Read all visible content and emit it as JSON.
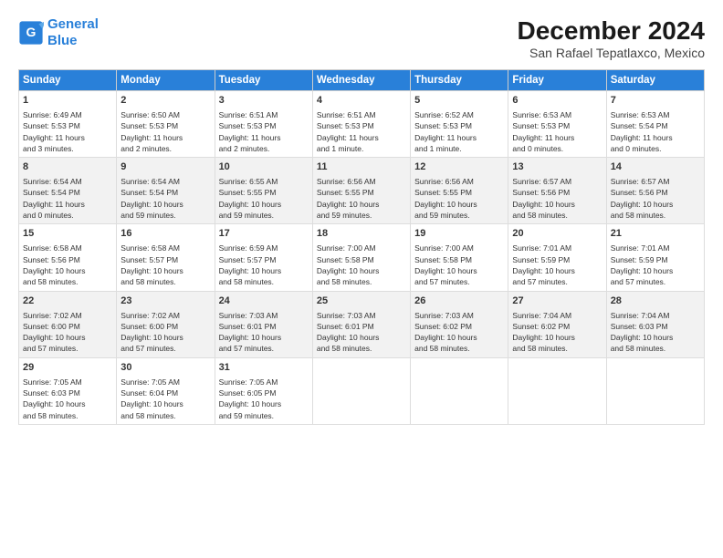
{
  "header": {
    "logo_line1": "General",
    "logo_line2": "Blue",
    "main_title": "December 2024",
    "subtitle": "San Rafael Tepatlaxco, Mexico"
  },
  "columns": [
    "Sunday",
    "Monday",
    "Tuesday",
    "Wednesday",
    "Thursday",
    "Friday",
    "Saturday"
  ],
  "weeks": [
    [
      {
        "day": "1",
        "info": "Sunrise: 6:49 AM\nSunset: 5:53 PM\nDaylight: 11 hours\nand 3 minutes."
      },
      {
        "day": "2",
        "info": "Sunrise: 6:50 AM\nSunset: 5:53 PM\nDaylight: 11 hours\nand 2 minutes."
      },
      {
        "day": "3",
        "info": "Sunrise: 6:51 AM\nSunset: 5:53 PM\nDaylight: 11 hours\nand 2 minutes."
      },
      {
        "day": "4",
        "info": "Sunrise: 6:51 AM\nSunset: 5:53 PM\nDaylight: 11 hours\nand 1 minute."
      },
      {
        "day": "5",
        "info": "Sunrise: 6:52 AM\nSunset: 5:53 PM\nDaylight: 11 hours\nand 1 minute."
      },
      {
        "day": "6",
        "info": "Sunrise: 6:53 AM\nSunset: 5:53 PM\nDaylight: 11 hours\nand 0 minutes."
      },
      {
        "day": "7",
        "info": "Sunrise: 6:53 AM\nSunset: 5:54 PM\nDaylight: 11 hours\nand 0 minutes."
      }
    ],
    [
      {
        "day": "8",
        "info": "Sunrise: 6:54 AM\nSunset: 5:54 PM\nDaylight: 11 hours\nand 0 minutes."
      },
      {
        "day": "9",
        "info": "Sunrise: 6:54 AM\nSunset: 5:54 PM\nDaylight: 10 hours\nand 59 minutes."
      },
      {
        "day": "10",
        "info": "Sunrise: 6:55 AM\nSunset: 5:55 PM\nDaylight: 10 hours\nand 59 minutes."
      },
      {
        "day": "11",
        "info": "Sunrise: 6:56 AM\nSunset: 5:55 PM\nDaylight: 10 hours\nand 59 minutes."
      },
      {
        "day": "12",
        "info": "Sunrise: 6:56 AM\nSunset: 5:55 PM\nDaylight: 10 hours\nand 59 minutes."
      },
      {
        "day": "13",
        "info": "Sunrise: 6:57 AM\nSunset: 5:56 PM\nDaylight: 10 hours\nand 58 minutes."
      },
      {
        "day": "14",
        "info": "Sunrise: 6:57 AM\nSunset: 5:56 PM\nDaylight: 10 hours\nand 58 minutes."
      }
    ],
    [
      {
        "day": "15",
        "info": "Sunrise: 6:58 AM\nSunset: 5:56 PM\nDaylight: 10 hours\nand 58 minutes."
      },
      {
        "day": "16",
        "info": "Sunrise: 6:58 AM\nSunset: 5:57 PM\nDaylight: 10 hours\nand 58 minutes."
      },
      {
        "day": "17",
        "info": "Sunrise: 6:59 AM\nSunset: 5:57 PM\nDaylight: 10 hours\nand 58 minutes."
      },
      {
        "day": "18",
        "info": "Sunrise: 7:00 AM\nSunset: 5:58 PM\nDaylight: 10 hours\nand 58 minutes."
      },
      {
        "day": "19",
        "info": "Sunrise: 7:00 AM\nSunset: 5:58 PM\nDaylight: 10 hours\nand 57 minutes."
      },
      {
        "day": "20",
        "info": "Sunrise: 7:01 AM\nSunset: 5:59 PM\nDaylight: 10 hours\nand 57 minutes."
      },
      {
        "day": "21",
        "info": "Sunrise: 7:01 AM\nSunset: 5:59 PM\nDaylight: 10 hours\nand 57 minutes."
      }
    ],
    [
      {
        "day": "22",
        "info": "Sunrise: 7:02 AM\nSunset: 6:00 PM\nDaylight: 10 hours\nand 57 minutes."
      },
      {
        "day": "23",
        "info": "Sunrise: 7:02 AM\nSunset: 6:00 PM\nDaylight: 10 hours\nand 57 minutes."
      },
      {
        "day": "24",
        "info": "Sunrise: 7:03 AM\nSunset: 6:01 PM\nDaylight: 10 hours\nand 57 minutes."
      },
      {
        "day": "25",
        "info": "Sunrise: 7:03 AM\nSunset: 6:01 PM\nDaylight: 10 hours\nand 58 minutes."
      },
      {
        "day": "26",
        "info": "Sunrise: 7:03 AM\nSunset: 6:02 PM\nDaylight: 10 hours\nand 58 minutes."
      },
      {
        "day": "27",
        "info": "Sunrise: 7:04 AM\nSunset: 6:02 PM\nDaylight: 10 hours\nand 58 minutes."
      },
      {
        "day": "28",
        "info": "Sunrise: 7:04 AM\nSunset: 6:03 PM\nDaylight: 10 hours\nand 58 minutes."
      }
    ],
    [
      {
        "day": "29",
        "info": "Sunrise: 7:05 AM\nSunset: 6:03 PM\nDaylight: 10 hours\nand 58 minutes."
      },
      {
        "day": "30",
        "info": "Sunrise: 7:05 AM\nSunset: 6:04 PM\nDaylight: 10 hours\nand 58 minutes."
      },
      {
        "day": "31",
        "info": "Sunrise: 7:05 AM\nSunset: 6:05 PM\nDaylight: 10 hours\nand 59 minutes."
      },
      {
        "day": "",
        "info": ""
      },
      {
        "day": "",
        "info": ""
      },
      {
        "day": "",
        "info": ""
      },
      {
        "day": "",
        "info": ""
      }
    ]
  ]
}
